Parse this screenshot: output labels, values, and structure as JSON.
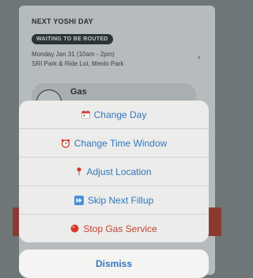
{
  "background_card": {
    "title": "NEXT YOSHI DAY",
    "status_badge": "WAITING TO BE ROUTED",
    "schedule_line1": "Monday Jan 31 (10am - 2pm)",
    "schedule_line2": "SRI Park & Ride Lot, Menlo Park",
    "service_label": "Gas"
  },
  "action_sheet": {
    "actions": [
      {
        "label": "Change Day",
        "icon": "calendar-icon"
      },
      {
        "label": "Change Time Window",
        "icon": "alarm-clock-icon"
      },
      {
        "label": "Adjust Location",
        "icon": "pin-icon"
      },
      {
        "label": "Skip Next Fillup",
        "icon": "fast-forward-icon"
      },
      {
        "label": "Stop Gas Service",
        "icon": "red-circle-icon"
      }
    ],
    "dismiss_label": "Dismiss"
  },
  "colors": {
    "action_blue": "#3278bf",
    "destructive_red": "#c24331"
  }
}
